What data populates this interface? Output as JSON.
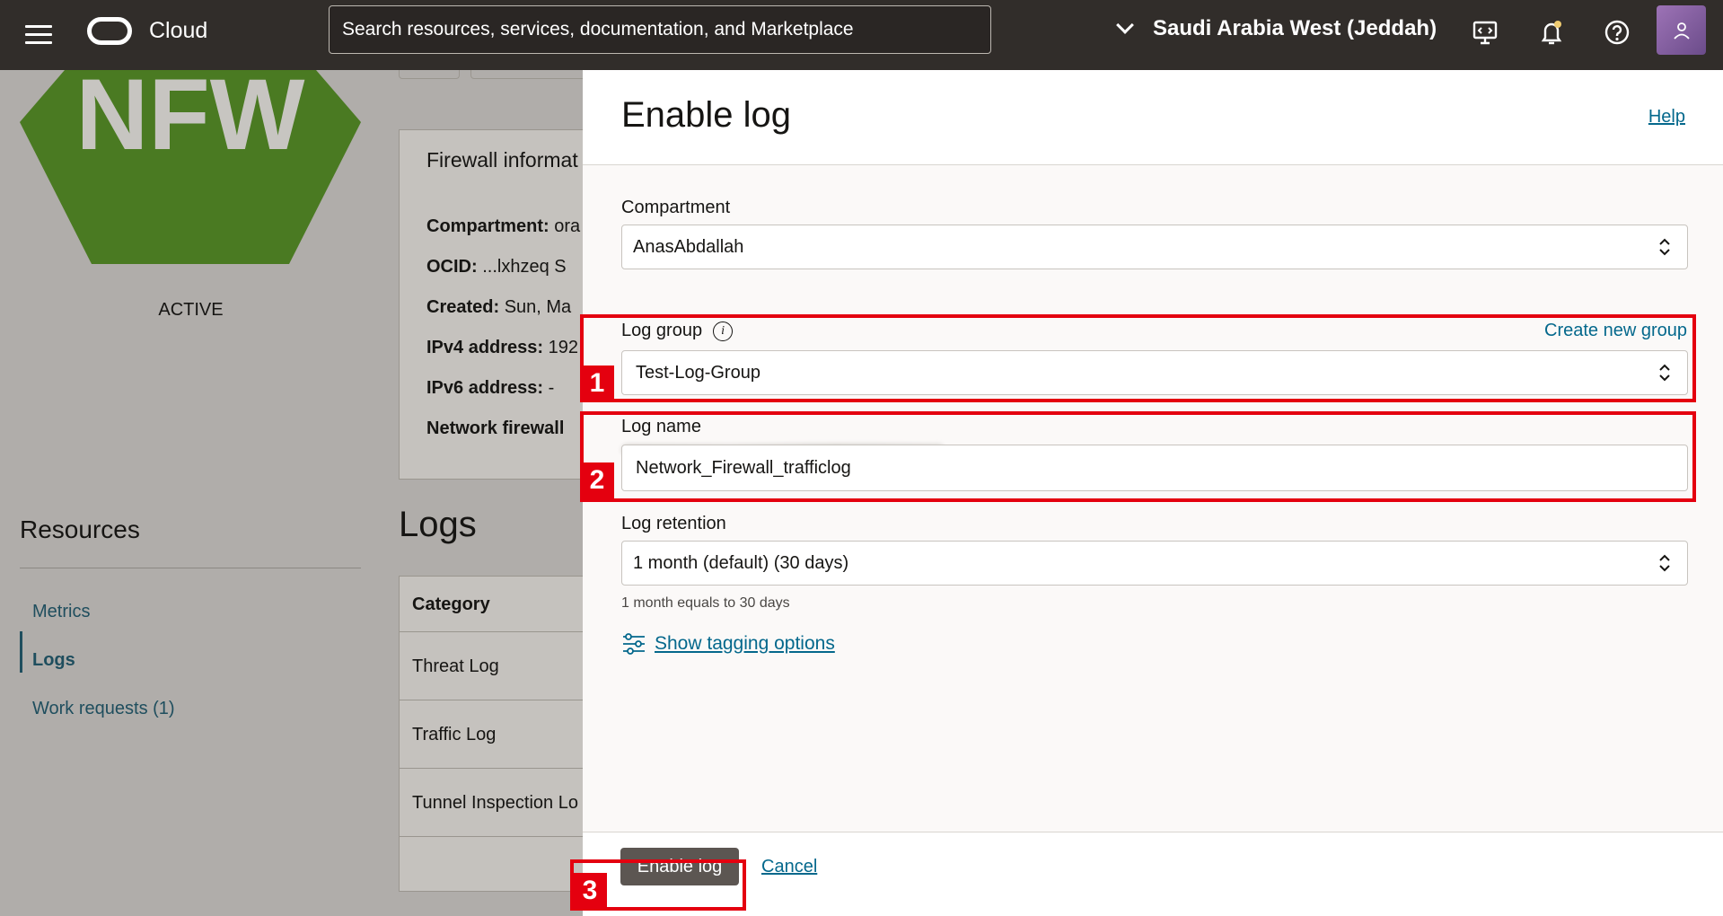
{
  "topbar": {
    "brand": "Cloud",
    "search_placeholder": "Search resources, services, documentation, and Marketplace",
    "region": "Saudi Arabia West (Jeddah)"
  },
  "background": {
    "logo_text": "NFW",
    "logo_color": "#4a7a22",
    "status": "ACTIVE",
    "info_title": "Firewall informat",
    "rows": [
      {
        "label": "Compartment:",
        "value": " ora"
      },
      {
        "label": "OCID:",
        "value": " ...lxhzeq  S"
      },
      {
        "label": "Created:",
        "value": " Sun, Ma"
      },
      {
        "label": "IPv4 address:",
        "value": " 192"
      },
      {
        "label": "IPv6 address:",
        "value": " -"
      },
      {
        "label": "Network firewall",
        "value": ""
      }
    ],
    "resources_title": "Resources",
    "resource_links": [
      "Metrics",
      "Logs",
      "Work requests (1)"
    ],
    "logs_title": "Logs",
    "logs_header": "Category",
    "logs_rows": [
      "Threat Log",
      "Traffic Log",
      "Tunnel Inspection Lo"
    ]
  },
  "panel": {
    "title": "Enable log",
    "help": "Help",
    "compartment_label": "Compartment",
    "compartment_value": "AnasAbdallah",
    "log_group_label": "Log group",
    "create_new_group": "Create new group",
    "log_group_value": "Test-Log-Group",
    "log_name_label": "Log name",
    "log_name_value": "Network_Firewall_trafficlog",
    "retention_label": "Log retention",
    "retention_value": "1 month (default) (30 days)",
    "retention_hint": "1 month equals to 30 days",
    "tagging": "Show tagging options",
    "enable_button": "Enable log",
    "cancel": "Cancel"
  },
  "annotations": [
    "1",
    "2",
    "3"
  ],
  "colors": {
    "annotation": "#e4000f",
    "link": "#04688c",
    "topbar": "#312d2a"
  }
}
